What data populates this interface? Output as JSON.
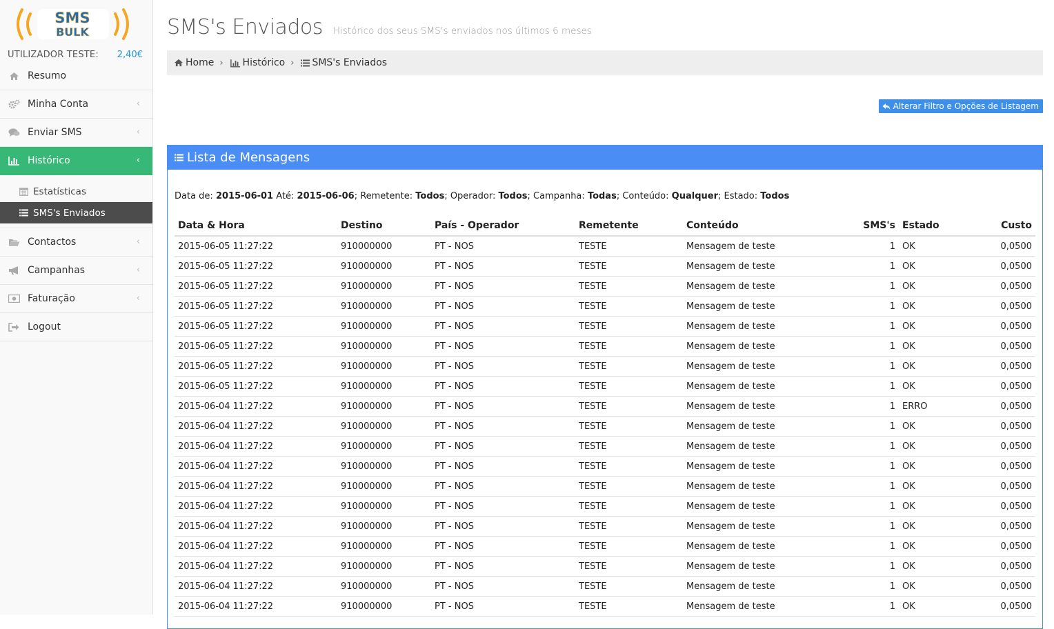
{
  "brand": {
    "logo_text_top": "SMS",
    "logo_text_bottom": "BULK",
    "colors": {
      "orange": "#f5a623",
      "blue": "#1f6fb5",
      "green": "#37b877",
      "panel_blue": "#4a8ef5"
    }
  },
  "user": {
    "label": "UTILIZADOR TESTE:",
    "balance": "2,40€"
  },
  "sidebar": {
    "items": [
      {
        "label": "Resumo",
        "icon": "home-icon"
      },
      {
        "label": "Minha Conta",
        "icon": "cogs-icon",
        "chevron": "‹"
      },
      {
        "label": "Enviar SMS",
        "icon": "comments-icon",
        "chevron": "‹"
      },
      {
        "label": "Histórico",
        "icon": "bar-chart-icon",
        "chevron": "‹"
      },
      {
        "label": "Contactos",
        "icon": "folder-open-icon",
        "chevron": "‹"
      },
      {
        "label": "Campanhas",
        "icon": "bullhorn-icon",
        "chevron": "‹"
      },
      {
        "label": "Faturação",
        "icon": "money-icon",
        "chevron": "‹"
      },
      {
        "label": "Logout",
        "icon": "sign-out-icon"
      }
    ],
    "submenu": [
      {
        "label": "Estatísticas",
        "icon": "calendar-icon"
      },
      {
        "label": "SMS's Enviados",
        "icon": "list-icon"
      }
    ]
  },
  "header": {
    "title": "SMS's Enviados",
    "subtitle": "Histórico dos seus SMS's enviados nos últimos 6 meses"
  },
  "breadcrumb": [
    {
      "label": "Home"
    },
    {
      "label": "Histórico"
    },
    {
      "label": "SMS's Enviados"
    }
  ],
  "filter_button": {
    "label": "Alterar Filtro e Opções de Listagem"
  },
  "panel": {
    "title": "Lista de Mensagens"
  },
  "filter": {
    "from_label": "Data de:",
    "from": "2015-06-01",
    "to_label": "Até:",
    "to": "2015-06-06",
    "sender_label": "; Remetente:",
    "sender": "Todos",
    "operator_label": "; Operador:",
    "operator": "Todos",
    "campaign_label": "; Campanha:",
    "campaign": "Todas",
    "content_label": "; Conteúdo:",
    "content": "Qualquer",
    "state_label": "; Estado:",
    "state": "Todos",
    "sep": ";"
  },
  "table": {
    "headers": [
      "Data & Hora",
      "Destino",
      "País - Operador",
      "Remetente",
      "Conteúdo",
      "SMS's",
      "Estado",
      "Custo"
    ],
    "rows": [
      [
        "2015-06-05 11:27:22",
        "910000000",
        "PT - NOS",
        "TESTE",
        "Mensagem de teste",
        "1",
        "OK",
        "0,0500"
      ],
      [
        "2015-06-05 11:27:22",
        "910000000",
        "PT - NOS",
        "TESTE",
        "Mensagem de teste",
        "1",
        "OK",
        "0,0500"
      ],
      [
        "2015-06-05 11:27:22",
        "910000000",
        "PT - NOS",
        "TESTE",
        "Mensagem de teste",
        "1",
        "OK",
        "0,0500"
      ],
      [
        "2015-06-05 11:27:22",
        "910000000",
        "PT - NOS",
        "TESTE",
        "Mensagem de teste",
        "1",
        "OK",
        "0,0500"
      ],
      [
        "2015-06-05 11:27:22",
        "910000000",
        "PT - NOS",
        "TESTE",
        "Mensagem de teste",
        "1",
        "OK",
        "0,0500"
      ],
      [
        "2015-06-05 11:27:22",
        "910000000",
        "PT - NOS",
        "TESTE",
        "Mensagem de teste",
        "1",
        "OK",
        "0,0500"
      ],
      [
        "2015-06-05 11:27:22",
        "910000000",
        "PT - NOS",
        "TESTE",
        "Mensagem de teste",
        "1",
        "OK",
        "0,0500"
      ],
      [
        "2015-06-05 11:27:22",
        "910000000",
        "PT - NOS",
        "TESTE",
        "Mensagem de teste",
        "1",
        "OK",
        "0,0500"
      ],
      [
        "2015-06-04 11:27:22",
        "910000000",
        "PT - NOS",
        "TESTE",
        "Mensagem de teste",
        "1",
        "ERRO",
        "0,0500"
      ],
      [
        "2015-06-04 11:27:22",
        "910000000",
        "PT - NOS",
        "TESTE",
        "Mensagem de teste",
        "1",
        "OK",
        "0,0500"
      ],
      [
        "2015-06-04 11:27:22",
        "910000000",
        "PT - NOS",
        "TESTE",
        "Mensagem de teste",
        "1",
        "OK",
        "0,0500"
      ],
      [
        "2015-06-04 11:27:22",
        "910000000",
        "PT - NOS",
        "TESTE",
        "Mensagem de teste",
        "1",
        "OK",
        "0,0500"
      ],
      [
        "2015-06-04 11:27:22",
        "910000000",
        "PT - NOS",
        "TESTE",
        "Mensagem de teste",
        "1",
        "OK",
        "0,0500"
      ],
      [
        "2015-06-04 11:27:22",
        "910000000",
        "PT - NOS",
        "TESTE",
        "Mensagem de teste",
        "1",
        "OK",
        "0,0500"
      ],
      [
        "2015-06-04 11:27:22",
        "910000000",
        "PT - NOS",
        "TESTE",
        "Mensagem de teste",
        "1",
        "OK",
        "0,0500"
      ],
      [
        "2015-06-04 11:27:22",
        "910000000",
        "PT - NOS",
        "TESTE",
        "Mensagem de teste",
        "1",
        "OK",
        "0,0500"
      ],
      [
        "2015-06-04 11:27:22",
        "910000000",
        "PT - NOS",
        "TESTE",
        "Mensagem de teste",
        "1",
        "OK",
        "0,0500"
      ],
      [
        "2015-06-04 11:27:22",
        "910000000",
        "PT - NOS",
        "TESTE",
        "Mensagem de teste",
        "1",
        "OK",
        "0,0500"
      ],
      [
        "2015-06-04 11:27:22",
        "910000000",
        "PT - NOS",
        "TESTE",
        "Mensagem de teste",
        "1",
        "OK",
        "0,0500"
      ]
    ]
  }
}
